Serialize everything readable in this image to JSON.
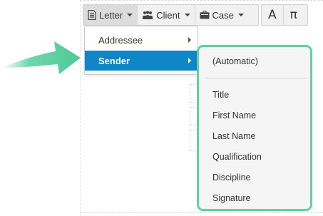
{
  "toolbar": {
    "letter_label": "Letter",
    "client_label": "Client",
    "case_label": "Case",
    "text_symbol": "A",
    "special_char_symbol": "π"
  },
  "menu": {
    "items": [
      {
        "label": "Addressee"
      },
      {
        "label": "Sender"
      }
    ]
  },
  "submenu": {
    "automatic": "(Automatic)",
    "items": [
      {
        "label": "Title"
      },
      {
        "label": "First Name"
      },
      {
        "label": "Last Name"
      },
      {
        "label": "Qualification"
      },
      {
        "label": "Discipline"
      },
      {
        "label": "Signature"
      }
    ]
  },
  "colors": {
    "selected": "#0f86c8",
    "highlight": "#5fd2a4"
  },
  "icons": {
    "letter": "document-icon",
    "client": "people-icon",
    "case": "briefcase-icon",
    "pointer": "green-arrow-icon"
  }
}
